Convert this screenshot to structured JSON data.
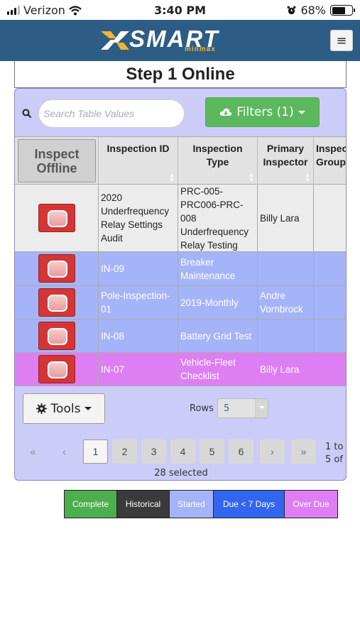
{
  "status_bar": {
    "carrier": "Verizon",
    "time": "3:40 PM",
    "battery": "68%"
  },
  "header": {
    "logo_text": "SMART",
    "logo_subtext": "minmax",
    "menu_icon": "hamburger-icon"
  },
  "page": {
    "title": "Step 1 Online"
  },
  "search": {
    "placeholder": "Search Table Values",
    "icon": "search-icon"
  },
  "filters": {
    "label": "Filters (1)",
    "icon": "cloud-download-icon"
  },
  "table": {
    "columns": [
      {
        "label": "Inspect Offline"
      },
      {
        "label": "Inspection ID"
      },
      {
        "label": "Inspection Type"
      },
      {
        "label": "Primary Inspector"
      },
      {
        "label": "Inspector Groups"
      }
    ],
    "rows": [
      {
        "status": "white",
        "id": "2020 Underfrequency Relay Settings Audit",
        "type": "PRC-005-PRC006-PRC-008 Underfrequency Relay Testing",
        "inspector": "Billy Lara",
        "groups": ""
      },
      {
        "status": "started",
        "id": "IN-09",
        "type": "Breaker Maintenance",
        "inspector": "",
        "groups": ""
      },
      {
        "status": "started",
        "id": "Pole-Inspection-01",
        "type": "2019-Monthly",
        "inspector": "Andre Vornbrock",
        "groups": ""
      },
      {
        "status": "started",
        "id": "IN-08",
        "type": "Battery Grid Test",
        "inspector": "",
        "groups": ""
      },
      {
        "status": "overdue",
        "id": "IN-07",
        "type": "Vehicle-Fleet Checklist",
        "inspector": "Billy Lara",
        "groups": ""
      }
    ]
  },
  "tools": {
    "label": "Tools",
    "icon": "gear-icon"
  },
  "rows_per_page": {
    "label": "Rows",
    "value": "5"
  },
  "pagination": {
    "first": "«",
    "prev": "‹",
    "pages": [
      "1",
      "2",
      "3",
      "4",
      "5",
      "6"
    ],
    "current": "1",
    "next": "›",
    "last": "»",
    "range_line1": "1 to",
    "range_line2": "5 of",
    "selected": "28 selected"
  },
  "legend": [
    {
      "label": "Complete",
      "color": "#4cae4c"
    },
    {
      "label": "Historical",
      "color": "#3a3a3a"
    },
    {
      "label": "Started",
      "color": "#a5b4f8"
    },
    {
      "label": "Due < 7 Days",
      "color": "#3366ee"
    },
    {
      "label": "Over Due",
      "color": "#dd7ff2"
    }
  ]
}
